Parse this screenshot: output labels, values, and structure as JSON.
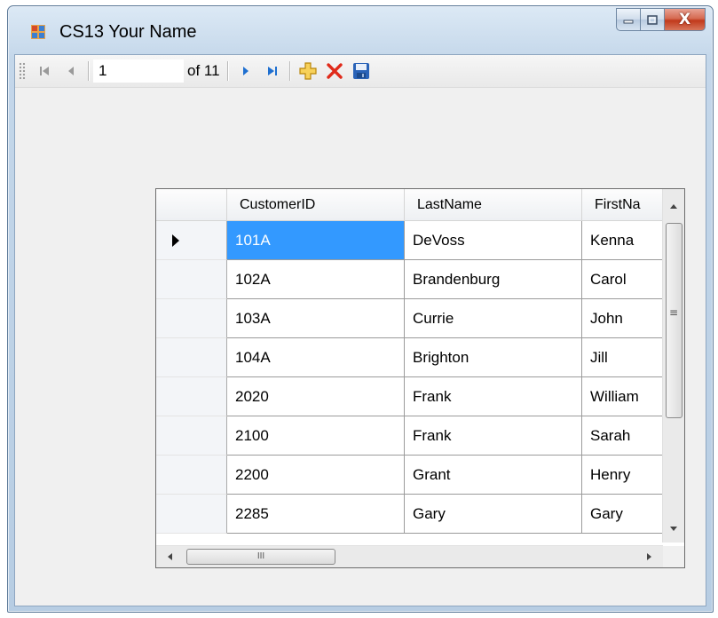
{
  "window": {
    "title": "CS13 Your Name",
    "caption": {
      "close_glyph": "X"
    }
  },
  "navigator": {
    "position_value": "1",
    "count_label": "of 11",
    "icons": [
      "move-first-icon",
      "move-previous-icon",
      "move-next-icon",
      "move-last-icon",
      "add-new-icon",
      "delete-icon",
      "save-icon"
    ]
  },
  "grid": {
    "columns": [
      "CustomerID",
      "LastName",
      "FirstNa"
    ],
    "rows": [
      [
        "101A",
        "DeVoss",
        "Kenna"
      ],
      [
        "102A",
        "Brandenburg",
        "Carol"
      ],
      [
        "103A",
        "Currie",
        "John"
      ],
      [
        "104A",
        "Brighton",
        "Jill"
      ],
      [
        "2020",
        "Frank",
        "William"
      ],
      [
        "2100",
        "Frank",
        "Sarah"
      ],
      [
        "2200",
        "Grant",
        "Henry"
      ],
      [
        "2285",
        "Gary",
        "Gary"
      ]
    ],
    "current_row": 0,
    "selected_cell": "101A",
    "hscroll_thumb_glyph": "III",
    "vscroll_grip_glyph": "≡"
  },
  "colors": {
    "selection": "#3399ff",
    "close_button": "#c1391b",
    "nav_arrow": "#1e6fd0",
    "add_icon": "#e8b21a",
    "delete_icon": "#e02a1a"
  }
}
